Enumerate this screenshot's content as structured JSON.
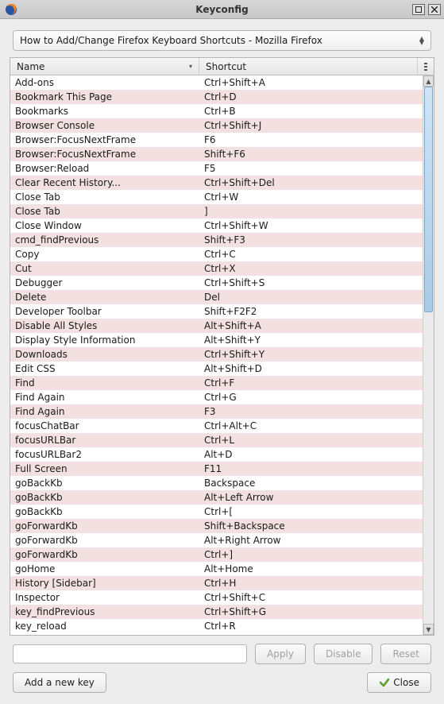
{
  "window": {
    "title": "Keyconfig"
  },
  "context_select": "How to Add/Change Firefox Keyboard Shortcuts - Mozilla Firefox",
  "columns": {
    "name": "Name",
    "shortcut": "Shortcut"
  },
  "rows": [
    {
      "name": "Add-ons",
      "shortcut": "Ctrl+Shift+A"
    },
    {
      "name": "Bookmark This Page",
      "shortcut": "Ctrl+D"
    },
    {
      "name": "Bookmarks",
      "shortcut": "Ctrl+B"
    },
    {
      "name": "Browser Console",
      "shortcut": "Ctrl+Shift+J"
    },
    {
      "name": "Browser:FocusNextFrame",
      "shortcut": "F6"
    },
    {
      "name": "Browser:FocusNextFrame",
      "shortcut": "Shift+F6"
    },
    {
      "name": "Browser:Reload",
      "shortcut": "F5"
    },
    {
      "name": "Clear Recent History...",
      "shortcut": "Ctrl+Shift+Del"
    },
    {
      "name": "Close Tab",
      "shortcut": "Ctrl+W"
    },
    {
      "name": "Close Tab",
      "shortcut": "]"
    },
    {
      "name": "Close Window",
      "shortcut": "Ctrl+Shift+W"
    },
    {
      "name": "cmd_findPrevious",
      "shortcut": "Shift+F3"
    },
    {
      "name": "Copy",
      "shortcut": "Ctrl+C"
    },
    {
      "name": "Cut",
      "shortcut": "Ctrl+X"
    },
    {
      "name": "Debugger",
      "shortcut": "Ctrl+Shift+S"
    },
    {
      "name": "Delete",
      "shortcut": "Del"
    },
    {
      "name": "Developer Toolbar",
      "shortcut": "Shift+F2F2"
    },
    {
      "name": "Disable All Styles",
      "shortcut": "Alt+Shift+A"
    },
    {
      "name": "Display Style Information",
      "shortcut": "Alt+Shift+Y"
    },
    {
      "name": "Downloads",
      "shortcut": "Ctrl+Shift+Y"
    },
    {
      "name": "Edit CSS",
      "shortcut": "Alt+Shift+D"
    },
    {
      "name": "Find",
      "shortcut": "Ctrl+F"
    },
    {
      "name": "Find Again",
      "shortcut": "Ctrl+G"
    },
    {
      "name": "Find Again",
      "shortcut": "F3"
    },
    {
      "name": "focusChatBar",
      "shortcut": "Ctrl+Alt+C"
    },
    {
      "name": "focusURLBar",
      "shortcut": "Ctrl+L"
    },
    {
      "name": "focusURLBar2",
      "shortcut": "Alt+D"
    },
    {
      "name": "Full Screen",
      "shortcut": "F11"
    },
    {
      "name": "goBackKb",
      "shortcut": "Backspace"
    },
    {
      "name": "goBackKb",
      "shortcut": "Alt+Left Arrow"
    },
    {
      "name": "goBackKb",
      "shortcut": "Ctrl+["
    },
    {
      "name": "goForwardKb",
      "shortcut": "Shift+Backspace"
    },
    {
      "name": "goForwardKb",
      "shortcut": "Alt+Right Arrow"
    },
    {
      "name": "goForwardKb",
      "shortcut": "Ctrl+]"
    },
    {
      "name": "goHome",
      "shortcut": "Alt+Home"
    },
    {
      "name": "History [Sidebar]",
      "shortcut": "Ctrl+H"
    },
    {
      "name": "Inspector",
      "shortcut": "Ctrl+Shift+C"
    },
    {
      "name": "key_findPrevious",
      "shortcut": "Ctrl+Shift+G"
    },
    {
      "name": "key_reload",
      "shortcut": "Ctrl+R"
    }
  ],
  "buttons": {
    "apply": "Apply",
    "disable": "Disable",
    "reset": "Reset",
    "add": "Add a new key",
    "close": "Close"
  }
}
